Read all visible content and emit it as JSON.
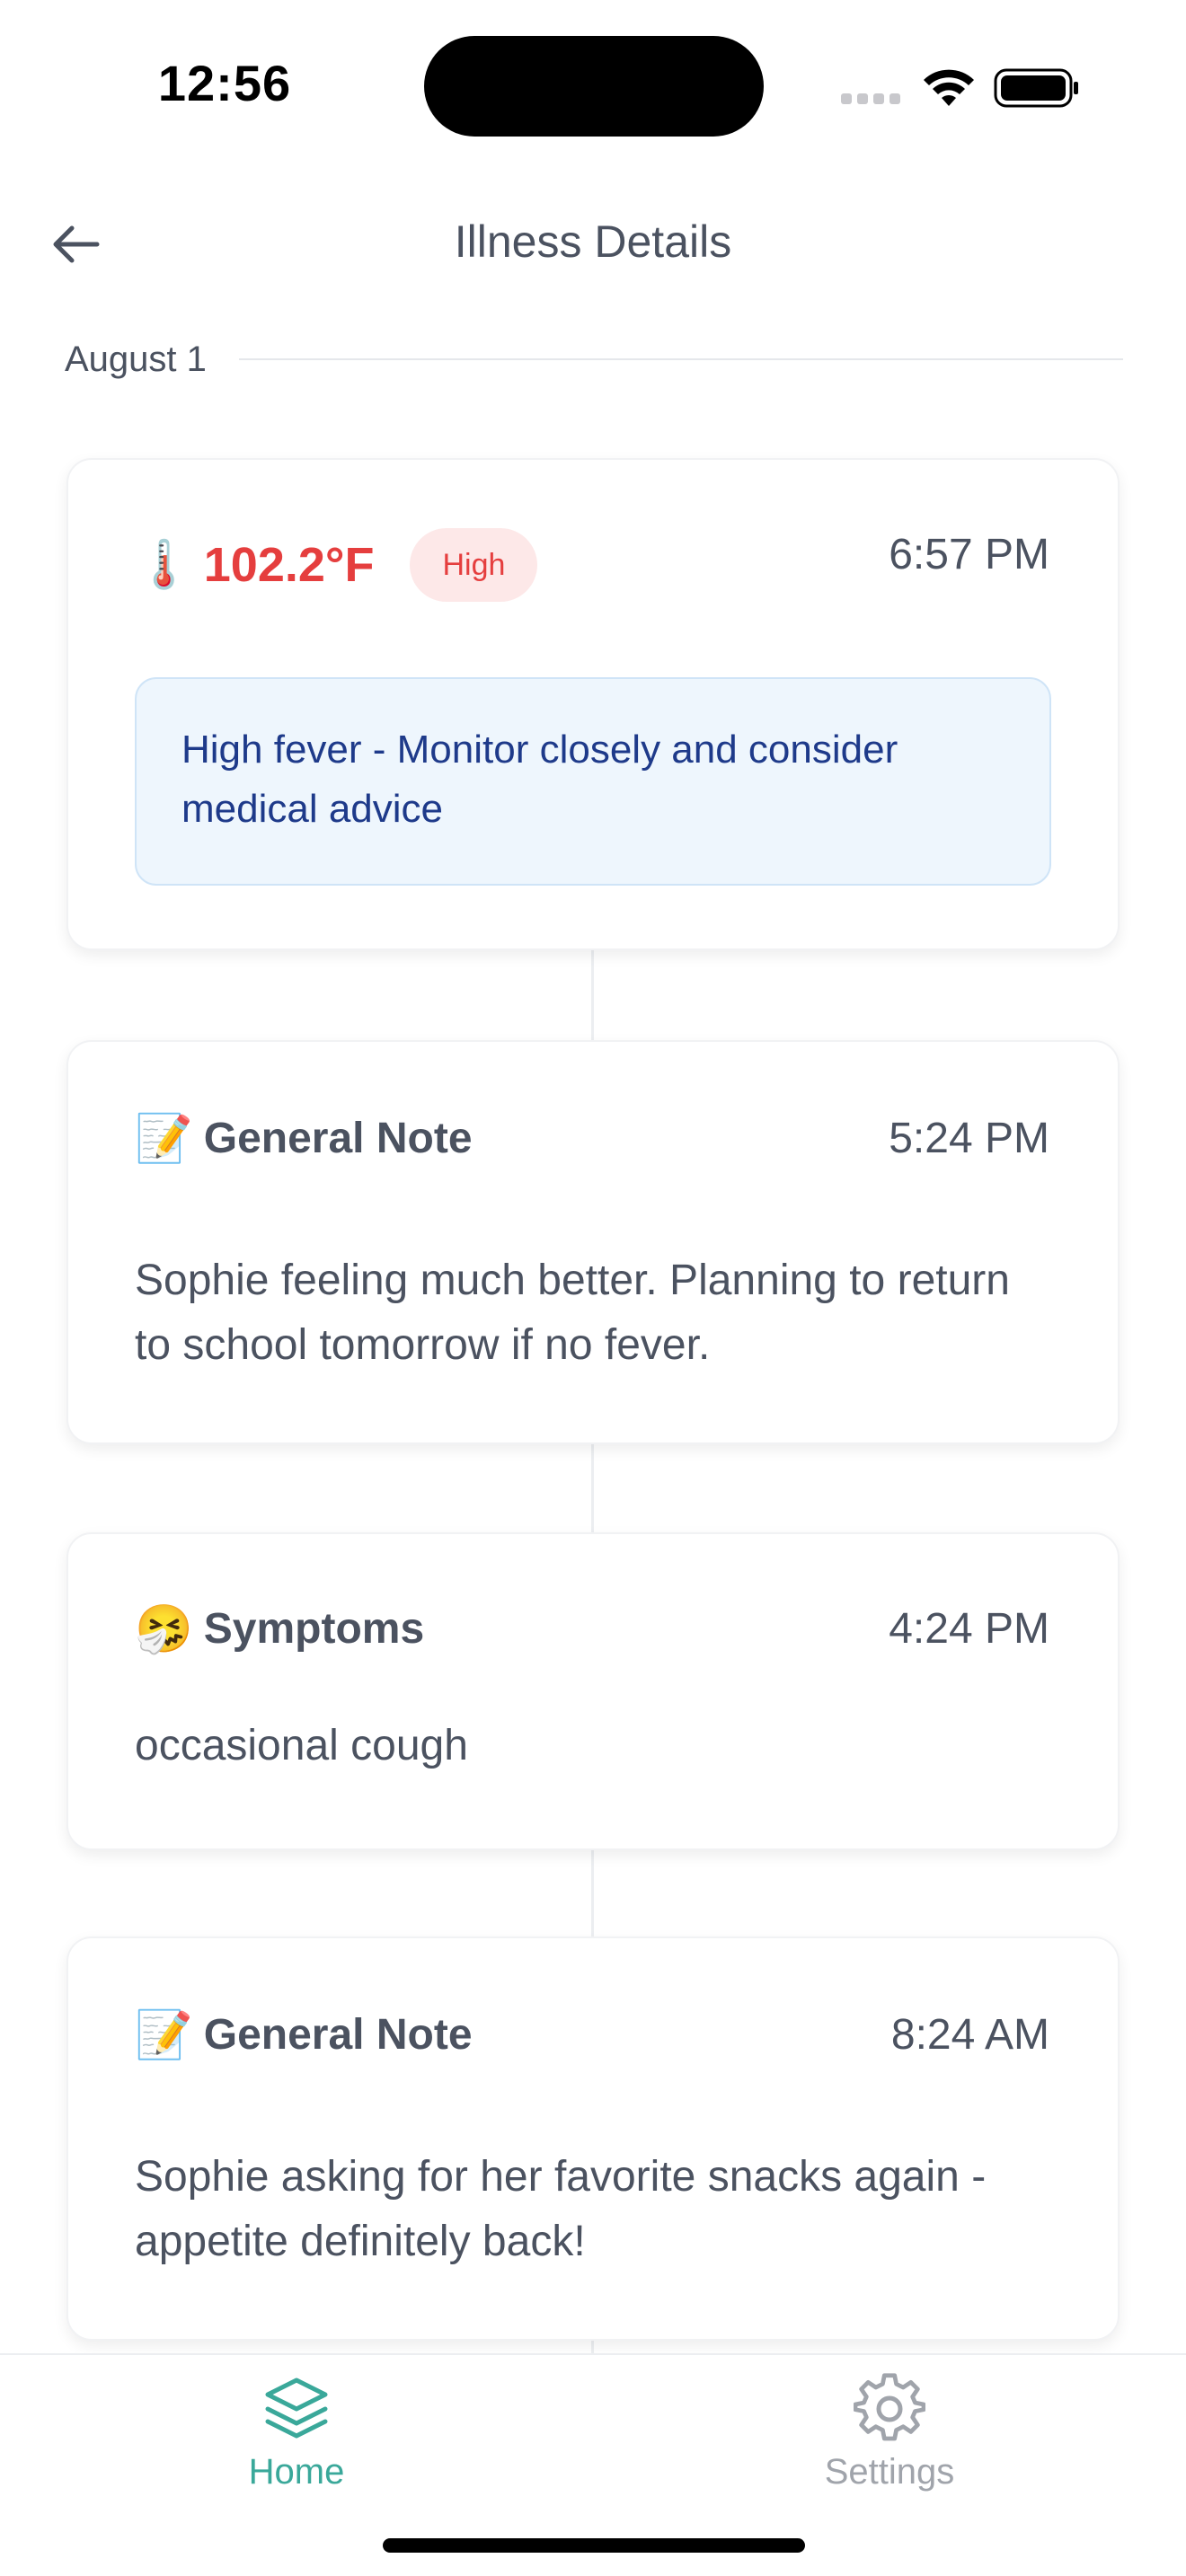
{
  "status_bar": {
    "time": "12:56"
  },
  "header": {
    "title": "Illness Details"
  },
  "date_label": "August 1",
  "entries": [
    {
      "type": "temperature",
      "icon": "thermometer-icon",
      "emoji": "🌡️",
      "value": "102.2°F",
      "badge": "High",
      "time": "6:57 PM",
      "advice": "High fever - Monitor closely and consider medical advice"
    },
    {
      "type": "note",
      "icon": "memo-icon",
      "emoji": "📝",
      "title": "General Note",
      "time": "5:24 PM",
      "text": "Sophie feeling much better. Planning to return to school tomorrow if no fever."
    },
    {
      "type": "symptoms",
      "icon": "sneezing-face-icon",
      "emoji": "🤧",
      "title": "Symptoms",
      "time": "4:24 PM",
      "text": "occasional cough"
    },
    {
      "type": "note",
      "icon": "memo-icon",
      "emoji": "📝",
      "title": "General Note",
      "time": "8:24 AM",
      "text": "Sophie asking for her favorite snacks again - appetite definitely back!"
    }
  ],
  "tab_bar": {
    "home": {
      "label": "Home",
      "icon": "layers-icon",
      "active": true
    },
    "settings": {
      "label": "Settings",
      "icon": "gear-icon",
      "active": false
    }
  },
  "colors": {
    "accent": "#3aa89a",
    "fever": "#e53e3e",
    "advice_text": "#1e3a8a",
    "advice_bg": "#eef6fd",
    "text": "#4b5260"
  }
}
